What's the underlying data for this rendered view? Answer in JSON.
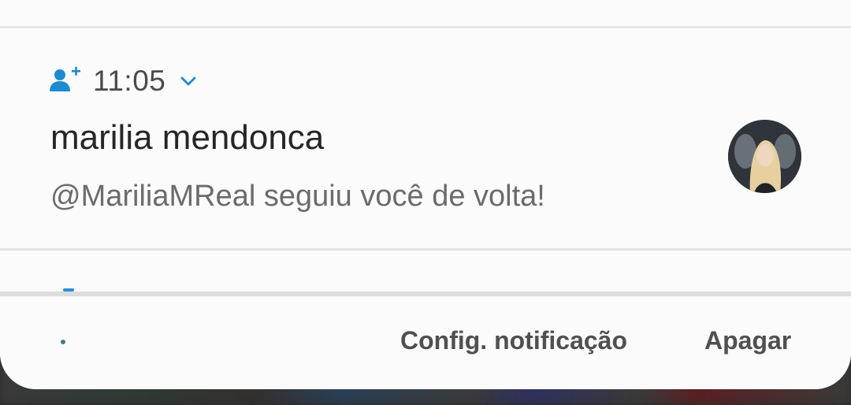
{
  "notification": {
    "time": "11:05",
    "title": "marilia mendonca",
    "body": "@MariliaMReal seguiu você de volta!",
    "app_icon": "person-add-icon",
    "expand_icon": "chevron-down-icon",
    "avatar": "profile-avatar"
  },
  "footer": {
    "settings_label": "Config. notificação",
    "clear_label": "Apagar"
  },
  "colors": {
    "accent": "#1d8ad1",
    "panel_background": "#fbfbfb",
    "title_text": "#262626",
    "body_text": "#6b6b6b",
    "button_text": "#505050"
  }
}
